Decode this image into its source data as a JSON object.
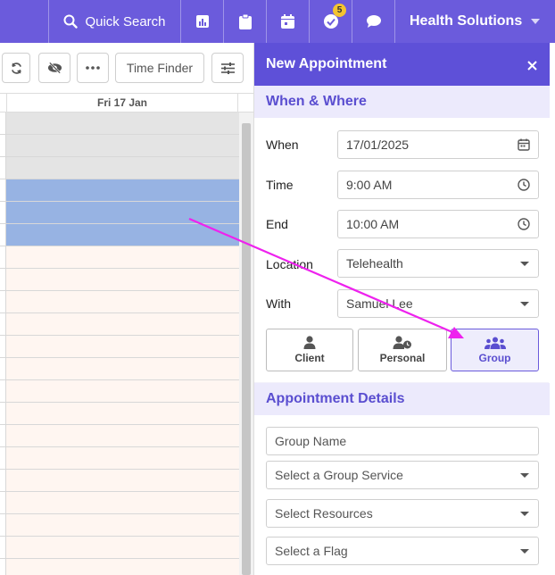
{
  "topbar": {
    "search_label": "Quick Search",
    "notification_count": "5",
    "org_name": "Health Solutions",
    "icons": [
      "search-icon",
      "reports-icon",
      "clipboard-icon",
      "calendar-icon",
      "tasks-icon",
      "chat-icon"
    ]
  },
  "calendar": {
    "toolbar": {
      "time_finder_label": "Time Finder"
    },
    "day_header": "Fri 17 Jan",
    "selection_color": "#97b3e3"
  },
  "panel": {
    "title": "New Appointment",
    "when_where": {
      "section_title": "When & Where",
      "when_label": "When",
      "when_value": "17/01/2025",
      "time_label": "Time",
      "time_value": "9:00 AM",
      "end_label": "End",
      "end_value": "10:00 AM",
      "location_label": "Location",
      "location_value": "Telehealth",
      "with_label": "With",
      "with_value": "Samuel Lee"
    },
    "types": [
      {
        "label": "Client",
        "icon": "client-icon"
      },
      {
        "label": "Personal",
        "icon": "personal-icon"
      },
      {
        "label": "Group",
        "icon": "group-icon",
        "active": true
      }
    ],
    "details": {
      "section_title": "Appointment Details",
      "group_name_placeholder": "Group Name",
      "group_service_placeholder": "Select a Group Service",
      "resources_placeholder": "Select Resources",
      "flag_placeholder": "Select a Flag"
    }
  },
  "colors": {
    "brand": "#6b5bdc",
    "panel_header": "#5e50d8",
    "accent_text": "#5a4ed0",
    "annotation_arrow": "#ee22ee"
  }
}
